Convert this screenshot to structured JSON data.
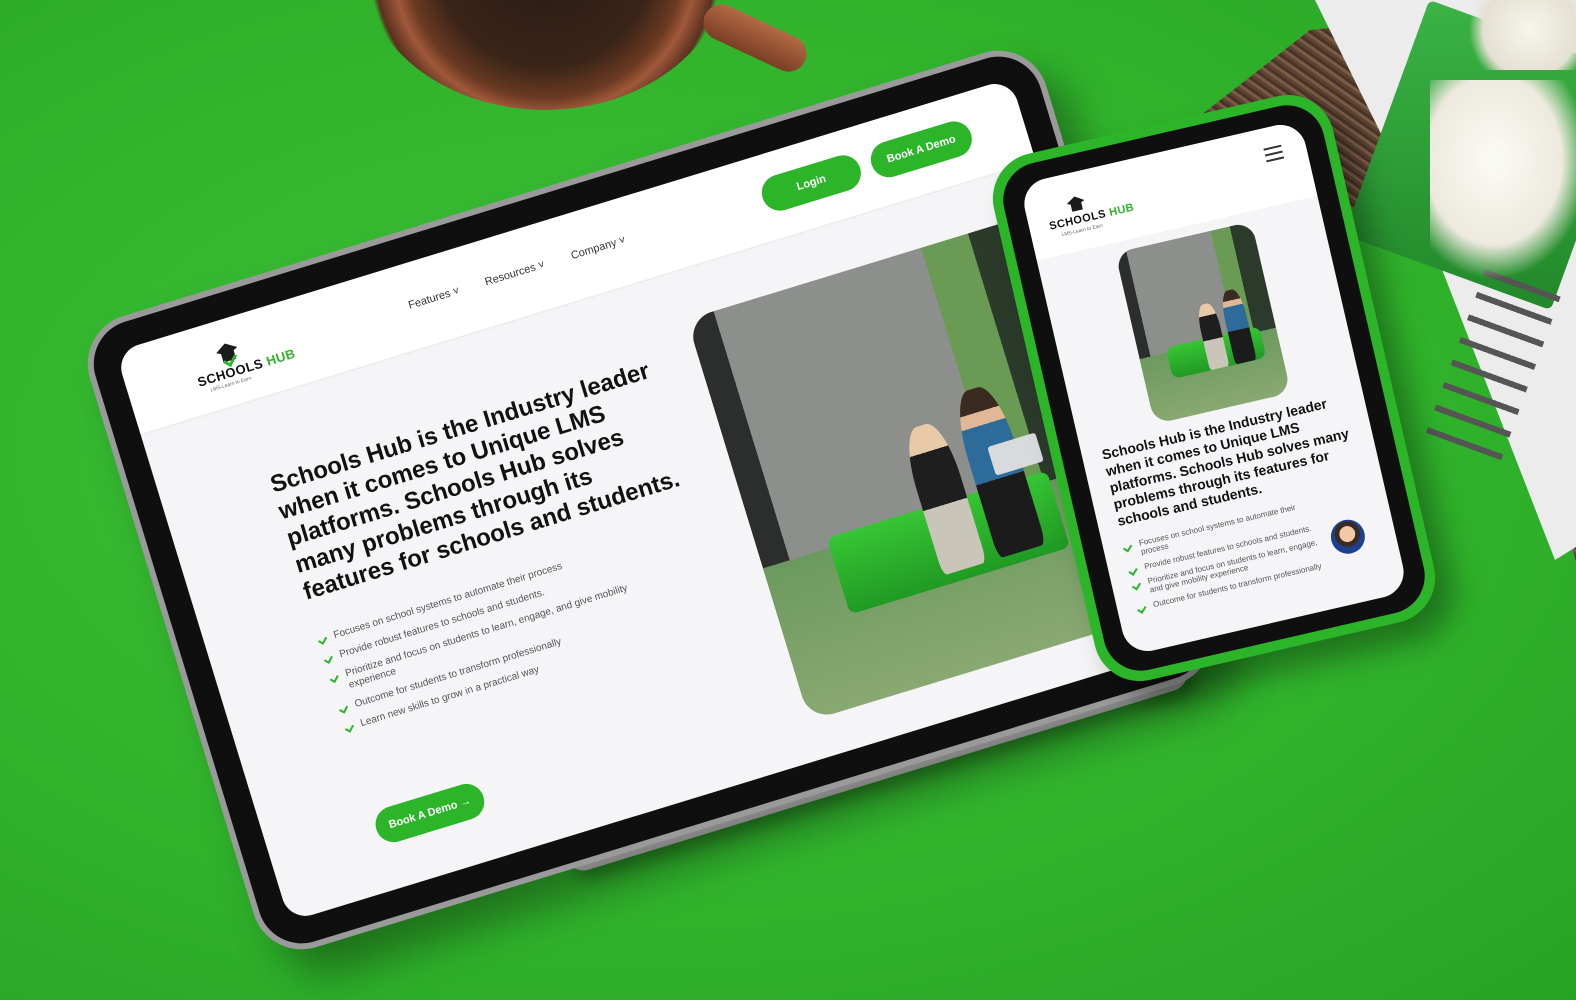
{
  "brand": {
    "name_part1": "SCHOOLS",
    "name_part2": "HUB",
    "tagline": "LMS-Learn to Earn"
  },
  "nav": {
    "items": [
      {
        "label": "Features"
      },
      {
        "label": "Resources"
      },
      {
        "label": "Company"
      }
    ],
    "login_label": "Login",
    "book_demo_label": "Book A Demo"
  },
  "hero": {
    "title": "Schools Hub is the Industry leader when it comes to Unique LMS platforms. Schools Hub solves many problems through its features for schools and students.",
    "points": [
      "Focuses on school systems to automate their process",
      "Provide robust features to schools and students.",
      "Prioritize and focus on students to learn, engage, and give mobility experience",
      "Outcome for students to transform professionally",
      "Learn new skills to grow in a practical way"
    ],
    "cta_label": "Book A Demo →"
  },
  "colors": {
    "accent": "#2db52a",
    "background": "#33b52e",
    "screen": "#f5f5f8"
  },
  "icons": {
    "check": "check-icon",
    "chevron": "chevron-down-icon",
    "menu": "hamburger-menu-icon"
  }
}
